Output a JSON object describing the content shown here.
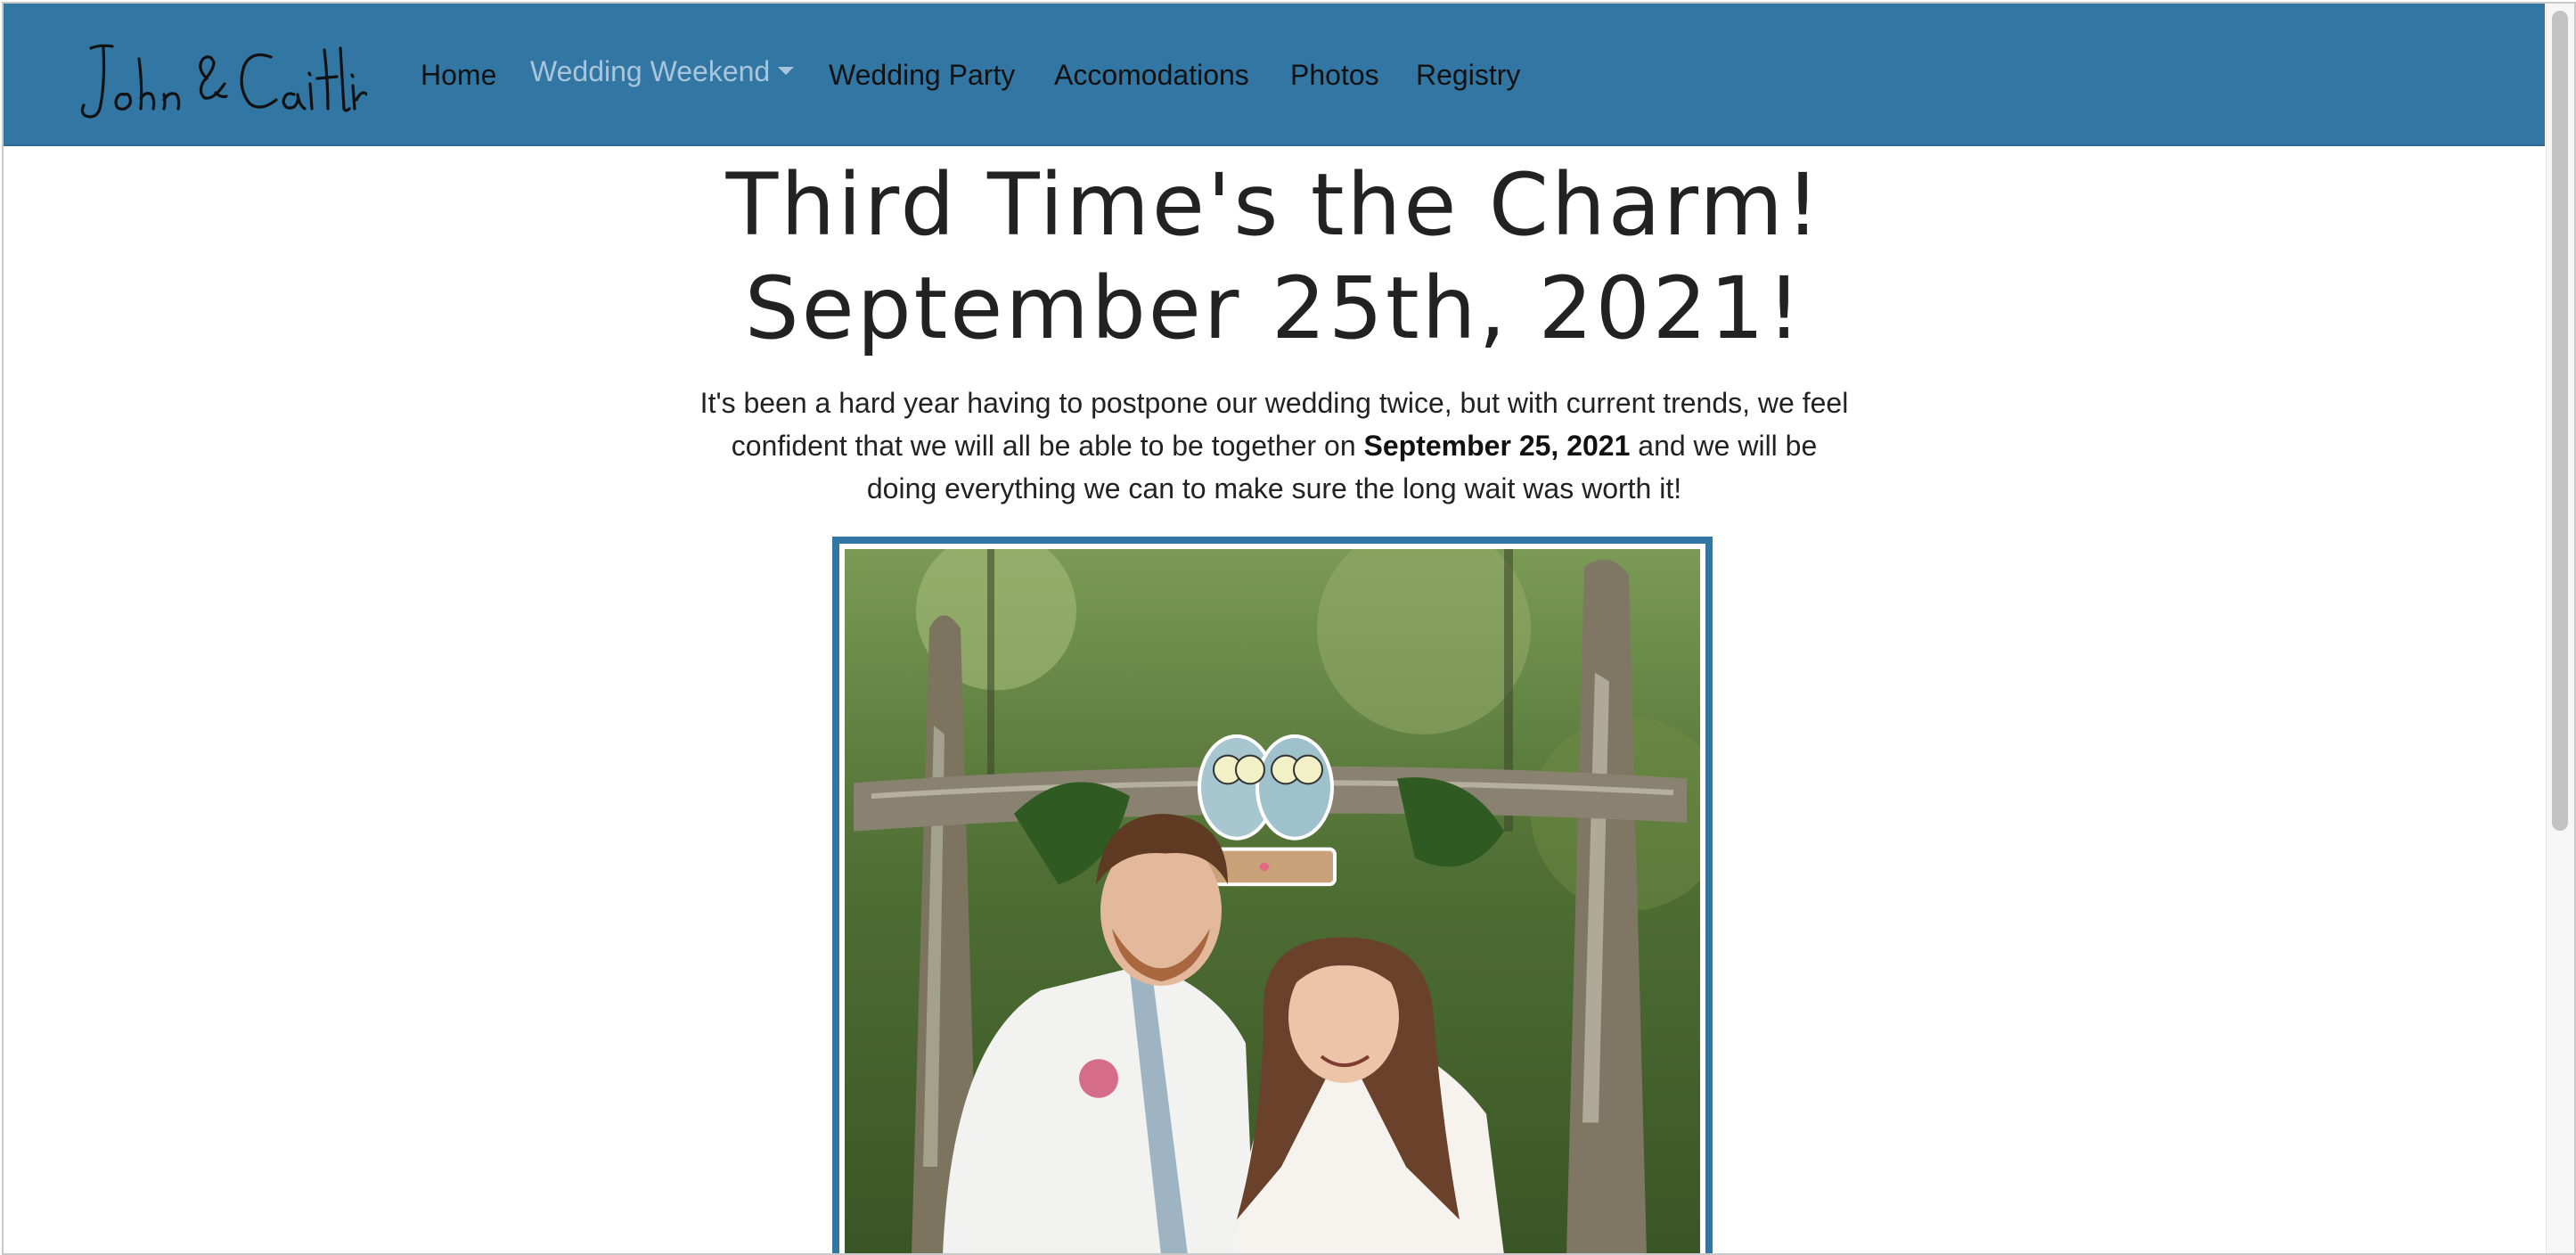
{
  "brand": {
    "text": "John & Caitlin"
  },
  "nav": {
    "items": [
      {
        "label": "Home"
      },
      {
        "label": "Wedding Weekend",
        "has_dropdown": true,
        "active": true
      },
      {
        "label": "Wedding Party"
      },
      {
        "label": "Accomodations"
      },
      {
        "label": "Photos"
      },
      {
        "label": "Registry"
      }
    ]
  },
  "hero": {
    "title_line1": "Third Time's the Charm!",
    "title_line2": "September 25th, 2021!",
    "intro_part1": "It's been a hard year having to postpone our wedding twice, but with current trends, we feel confident that we will all be able to be together on ",
    "intro_bold": "September 25, 2021",
    "intro_part2": " and we will be doing everything we can to make sure the long wait was worth it!"
  },
  "photo": {
    "subject": "couple-under-wooden-arch-with-owl-sign"
  },
  "colors": {
    "navbar": "#3277a4",
    "nav_active": "#a8c5dc",
    "text": "#222222",
    "frame": "#3277a4"
  }
}
